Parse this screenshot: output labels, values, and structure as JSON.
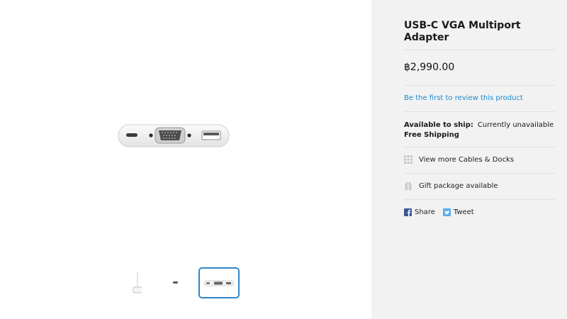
{
  "product": {
    "title": "USB-C VGA Multiport Adapter",
    "price": "฿2,990.00",
    "review_link": "Be the first to review this product",
    "availability_label": "Available to ship:",
    "availability_value": "Currently unavailable",
    "shipping": "Free Shipping"
  },
  "links": {
    "more_category": "View more Cables & Docks",
    "gift": "Gift package available"
  },
  "social": {
    "share": "Share",
    "tweet": "Tweet"
  },
  "gallery": {
    "selected_thumbnail": 3,
    "thumbnail_count": 3
  },
  "colors": {
    "accent": "#2e88cc",
    "link": "#1a8ad0",
    "facebook": "#3b5998",
    "twitter": "#55acee"
  }
}
